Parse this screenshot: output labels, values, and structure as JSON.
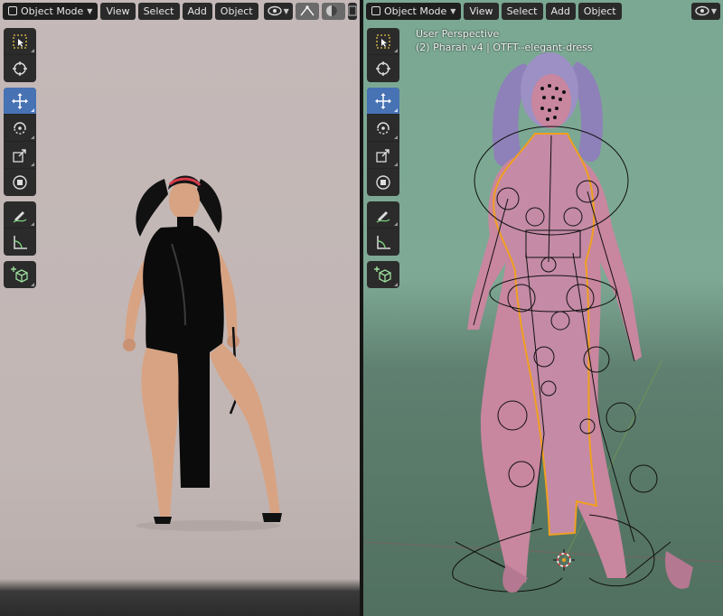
{
  "left_viewport": {
    "mode_label": "Object Mode",
    "menu": {
      "view": "View",
      "select": "Select",
      "add": "Add",
      "object": "Object"
    }
  },
  "right_viewport": {
    "mode_label": "Object Mode",
    "menu": {
      "view": "View",
      "select": "Select",
      "add": "Add",
      "object": "Object"
    },
    "overlay": {
      "title": "User Perspective",
      "object_info": "(2) Pharah v4 | OTFT--elegant-dress"
    }
  },
  "toolbar_icons": [
    "select-box-icon",
    "cursor-icon",
    "move-icon",
    "rotate-icon",
    "scale-icon",
    "transform-icon",
    "annotate-icon",
    "measure-icon",
    "add-cube-icon"
  ],
  "colors": {
    "active_tool": "#4772b3",
    "selection_outline": "#f0a020",
    "left_bg": "#c4b9b8",
    "right_bg": "#7ea995",
    "body_pink": "#c9869f"
  }
}
